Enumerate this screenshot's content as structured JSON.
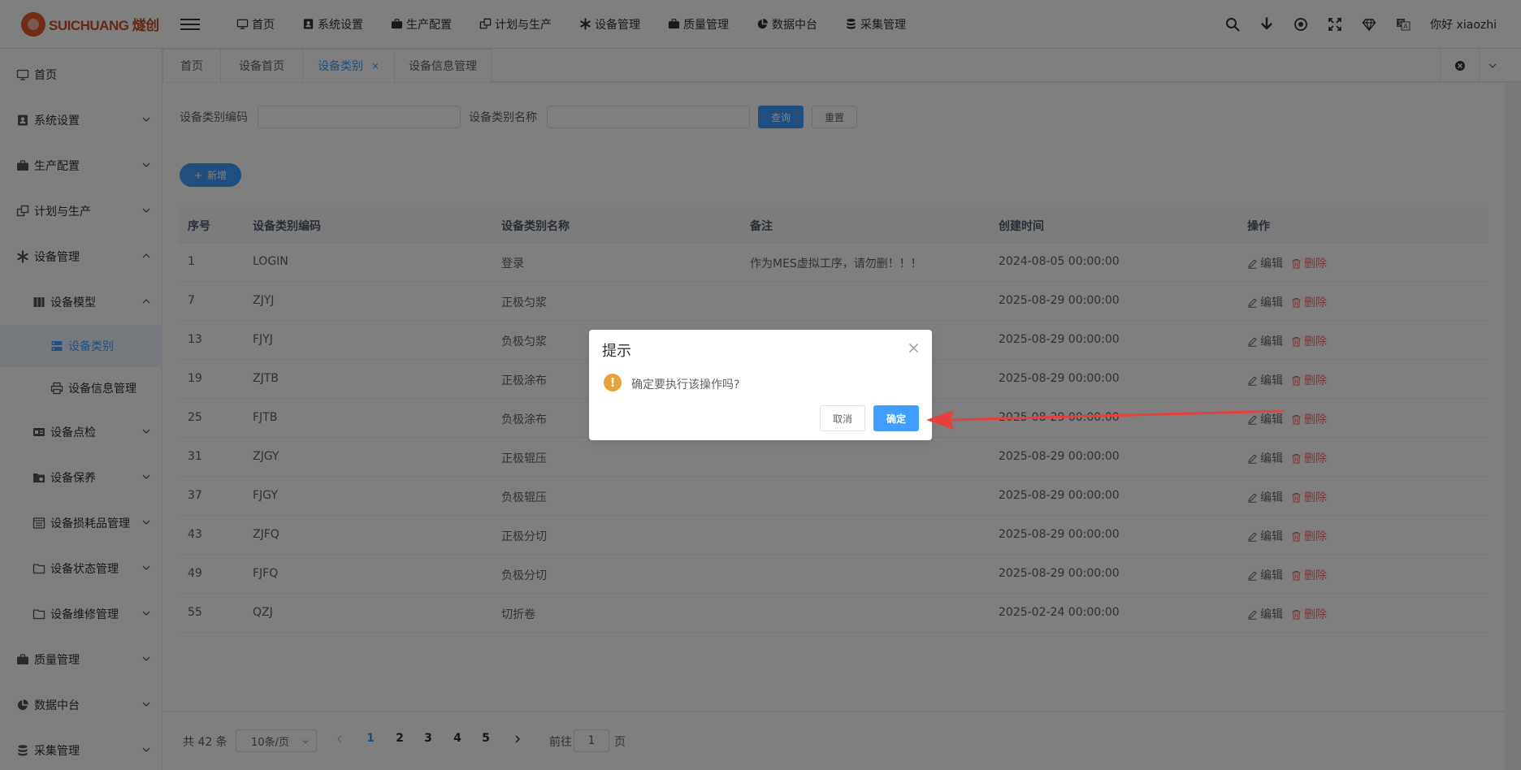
{
  "logo": {
    "text": "SUICHUANG 燧创"
  },
  "topnav": [
    {
      "label": "首页",
      "icon": "monitor-icon"
    },
    {
      "label": "系统设置",
      "icon": "user-badge-icon"
    },
    {
      "label": "生产配置",
      "icon": "briefcase-icon"
    },
    {
      "label": "计划与生产",
      "icon": "copy-icon"
    },
    {
      "label": "设备管理",
      "icon": "asterisk-icon"
    },
    {
      "label": "质量管理",
      "icon": "briefcase-icon"
    },
    {
      "label": "数据中台",
      "icon": "pie-icon"
    },
    {
      "label": "采集管理",
      "icon": "database-icon"
    }
  ],
  "topright": {
    "greeting": "你好 xiaozhi"
  },
  "sidebar": {
    "items": [
      {
        "label": "首页"
      },
      {
        "label": "系统设置"
      },
      {
        "label": "生产配置"
      },
      {
        "label": "计划与生产"
      },
      {
        "label": "设备管理"
      },
      {
        "label": "设备模型"
      },
      {
        "label": "设备类别"
      },
      {
        "label": "设备信息管理"
      },
      {
        "label": "设备点检"
      },
      {
        "label": "设备保养"
      },
      {
        "label": "设备损耗品管理"
      },
      {
        "label": "设备状态管理"
      },
      {
        "label": "设备维修管理"
      },
      {
        "label": "质量管理"
      },
      {
        "label": "数据中台"
      },
      {
        "label": "采集管理"
      }
    ]
  },
  "tabs": [
    {
      "label": "首页"
    },
    {
      "label": "设备首页"
    },
    {
      "label": "设备类别",
      "close": "×"
    },
    {
      "label": "设备信息管理"
    }
  ],
  "search": {
    "code_label": "设备类别编码",
    "name_label": "设备类别名称",
    "query_label": "查询",
    "reset_label": "重置"
  },
  "toolbar": {
    "add_label": "新增",
    "add_icon": "+"
  },
  "table": {
    "headers": [
      "序号",
      "设备类别编码",
      "设备类别名称",
      "备注",
      "创建时间",
      "操作"
    ],
    "rows": [
      {
        "id": "1",
        "code": "LOGIN",
        "name": "登录",
        "remark": "作为MES虚拟工序，请勿删！！！",
        "created": "2024-08-05 00:00:00"
      },
      {
        "id": "7",
        "code": "ZJYJ",
        "name": "正极匀浆",
        "remark": "",
        "created": "2025-08-29 00:00:00"
      },
      {
        "id": "13",
        "code": "FJYJ",
        "name": "负极匀浆",
        "remark": "",
        "created": "2025-08-29 00:00:00"
      },
      {
        "id": "19",
        "code": "ZJTB",
        "name": "正极涂布",
        "remark": "",
        "created": "2025-08-29 00:00:00"
      },
      {
        "id": "25",
        "code": "FJTB",
        "name": "负极涂布",
        "remark": "",
        "created": "2025-08-29 00:00:00"
      },
      {
        "id": "31",
        "code": "ZJGY",
        "name": "正极辊压",
        "remark": "",
        "created": "2025-08-29 00:00:00"
      },
      {
        "id": "37",
        "code": "FJGY",
        "name": "负极辊压",
        "remark": "",
        "created": "2025-08-29 00:00:00"
      },
      {
        "id": "43",
        "code": "ZJFQ",
        "name": "正极分切",
        "remark": "",
        "created": "2025-08-29 00:00:00"
      },
      {
        "id": "49",
        "code": "FJFQ",
        "name": "负极分切",
        "remark": "",
        "created": "2025-08-29 00:00:00"
      },
      {
        "id": "55",
        "code": "QZJ",
        "name": "切折卷",
        "remark": "",
        "created": "2025-02-24 00:00:00"
      }
    ],
    "edit_label": "编辑",
    "delete_label": "删除"
  },
  "pagination": {
    "total_text": "共 42 条",
    "page_size": "10条/页",
    "pages": [
      "1",
      "2",
      "3",
      "4",
      "5"
    ],
    "current": "1",
    "goto_prefix": "前往",
    "goto_value": "1",
    "goto_suffix": "页"
  },
  "dialog": {
    "title": "提示",
    "warn_icon": "!",
    "message": "确定要执行该操作吗?",
    "cancel_label": "取消",
    "ok_label": "确定"
  },
  "colors": {
    "primary": "#409eff",
    "danger": "#f56c6c",
    "warning": "#e6a23c",
    "annotation": "#e8413d",
    "brand": "#e0592a"
  }
}
